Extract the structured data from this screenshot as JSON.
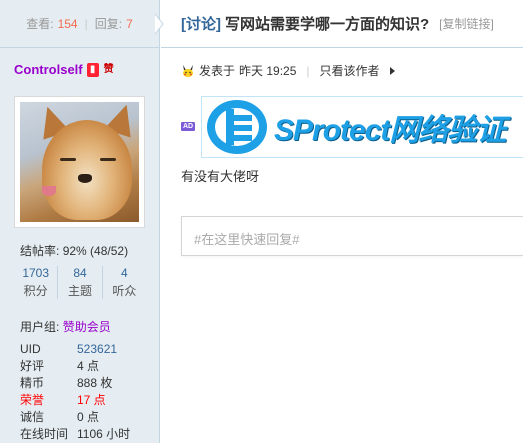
{
  "thread_stats": {
    "views_label": "查看:",
    "views": "154",
    "replies_label": "回复:",
    "replies": "7"
  },
  "thread": {
    "category": "[讨论]",
    "title": "写网站需要学哪一方面的知识?",
    "copy_link": "[复制链接]"
  },
  "author": {
    "username": "Controlself",
    "post_rate_label": "结帖率:",
    "post_rate": "92% (48/52)",
    "stats": [
      {
        "value": "1703",
        "label": "积分"
      },
      {
        "value": "84",
        "label": "主题"
      },
      {
        "value": "4",
        "label": "听众"
      }
    ],
    "group_label": "用户组:",
    "group": "赞助会员",
    "details": [
      {
        "key": "UID",
        "value": "523621"
      },
      {
        "key": "好评",
        "value": "4 点"
      },
      {
        "key": "精币",
        "value": "888 枚"
      },
      {
        "key": "荣誉",
        "value": "17 点"
      },
      {
        "key": "诚信",
        "value": "0 点"
      },
      {
        "key": "在线时间",
        "value": "1106 小时"
      }
    ]
  },
  "post": {
    "posted_prefix": "发表于",
    "posted_time": "昨天 19:25",
    "only_author": "只看该作者",
    "ad_tag": "AD",
    "banner_text": "SProtect网络验证",
    "body": "有没有大佬呀"
  },
  "quick_reply": {
    "placeholder": "#在这里快速回复#"
  },
  "colors": {
    "sidebar_bg": "#e5edf2",
    "link_blue": "#336699",
    "count_orange": "#f26c4f",
    "purple_user": "#9900cc",
    "honor_red": "#ff0000",
    "banner_blue": "#1ea0e6"
  }
}
